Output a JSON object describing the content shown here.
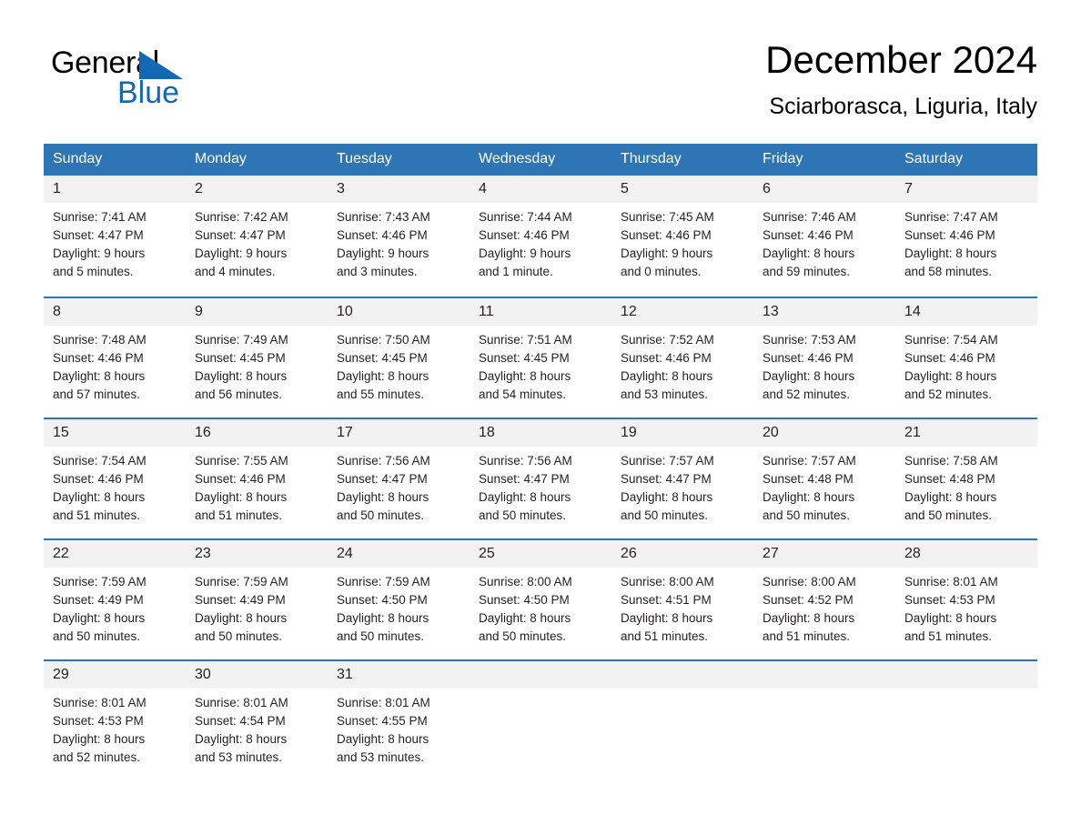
{
  "logo": {
    "word_one": "General",
    "word_two": "Blue",
    "triangle_color": "#1268b3",
    "blue_color": "#1268b3"
  },
  "header": {
    "month_title": "December 2024",
    "location": "Sciarborasca, Liguria, Italy"
  },
  "theme": {
    "header_blue": "#2e75b6",
    "day_number_bg": "#f2f2f2",
    "text": "#231f20"
  },
  "weekdays": [
    "Sunday",
    "Monday",
    "Tuesday",
    "Wednesday",
    "Thursday",
    "Friday",
    "Saturday"
  ],
  "weeks": [
    [
      {
        "day": "1",
        "sunrise": "Sunrise: 7:41 AM",
        "sunset": "Sunset: 4:47 PM",
        "daylight_line1": "Daylight: 9 hours",
        "daylight_line2": "and 5 minutes."
      },
      {
        "day": "2",
        "sunrise": "Sunrise: 7:42 AM",
        "sunset": "Sunset: 4:47 PM",
        "daylight_line1": "Daylight: 9 hours",
        "daylight_line2": "and 4 minutes."
      },
      {
        "day": "3",
        "sunrise": "Sunrise: 7:43 AM",
        "sunset": "Sunset: 4:46 PM",
        "daylight_line1": "Daylight: 9 hours",
        "daylight_line2": "and 3 minutes."
      },
      {
        "day": "4",
        "sunrise": "Sunrise: 7:44 AM",
        "sunset": "Sunset: 4:46 PM",
        "daylight_line1": "Daylight: 9 hours",
        "daylight_line2": "and 1 minute."
      },
      {
        "day": "5",
        "sunrise": "Sunrise: 7:45 AM",
        "sunset": "Sunset: 4:46 PM",
        "daylight_line1": "Daylight: 9 hours",
        "daylight_line2": "and 0 minutes."
      },
      {
        "day": "6",
        "sunrise": "Sunrise: 7:46 AM",
        "sunset": "Sunset: 4:46 PM",
        "daylight_line1": "Daylight: 8 hours",
        "daylight_line2": "and 59 minutes."
      },
      {
        "day": "7",
        "sunrise": "Sunrise: 7:47 AM",
        "sunset": "Sunset: 4:46 PM",
        "daylight_line1": "Daylight: 8 hours",
        "daylight_line2": "and 58 minutes."
      }
    ],
    [
      {
        "day": "8",
        "sunrise": "Sunrise: 7:48 AM",
        "sunset": "Sunset: 4:46 PM",
        "daylight_line1": "Daylight: 8 hours",
        "daylight_line2": "and 57 minutes."
      },
      {
        "day": "9",
        "sunrise": "Sunrise: 7:49 AM",
        "sunset": "Sunset: 4:45 PM",
        "daylight_line1": "Daylight: 8 hours",
        "daylight_line2": "and 56 minutes."
      },
      {
        "day": "10",
        "sunrise": "Sunrise: 7:50 AM",
        "sunset": "Sunset: 4:45 PM",
        "daylight_line1": "Daylight: 8 hours",
        "daylight_line2": "and 55 minutes."
      },
      {
        "day": "11",
        "sunrise": "Sunrise: 7:51 AM",
        "sunset": "Sunset: 4:45 PM",
        "daylight_line1": "Daylight: 8 hours",
        "daylight_line2": "and 54 minutes."
      },
      {
        "day": "12",
        "sunrise": "Sunrise: 7:52 AM",
        "sunset": "Sunset: 4:46 PM",
        "daylight_line1": "Daylight: 8 hours",
        "daylight_line2": "and 53 minutes."
      },
      {
        "day": "13",
        "sunrise": "Sunrise: 7:53 AM",
        "sunset": "Sunset: 4:46 PM",
        "daylight_line1": "Daylight: 8 hours",
        "daylight_line2": "and 52 minutes."
      },
      {
        "day": "14",
        "sunrise": "Sunrise: 7:54 AM",
        "sunset": "Sunset: 4:46 PM",
        "daylight_line1": "Daylight: 8 hours",
        "daylight_line2": "and 52 minutes."
      }
    ],
    [
      {
        "day": "15",
        "sunrise": "Sunrise: 7:54 AM",
        "sunset": "Sunset: 4:46 PM",
        "daylight_line1": "Daylight: 8 hours",
        "daylight_line2": "and 51 minutes."
      },
      {
        "day": "16",
        "sunrise": "Sunrise: 7:55 AM",
        "sunset": "Sunset: 4:46 PM",
        "daylight_line1": "Daylight: 8 hours",
        "daylight_line2": "and 51 minutes."
      },
      {
        "day": "17",
        "sunrise": "Sunrise: 7:56 AM",
        "sunset": "Sunset: 4:47 PM",
        "daylight_line1": "Daylight: 8 hours",
        "daylight_line2": "and 50 minutes."
      },
      {
        "day": "18",
        "sunrise": "Sunrise: 7:56 AM",
        "sunset": "Sunset: 4:47 PM",
        "daylight_line1": "Daylight: 8 hours",
        "daylight_line2": "and 50 minutes."
      },
      {
        "day": "19",
        "sunrise": "Sunrise: 7:57 AM",
        "sunset": "Sunset: 4:47 PM",
        "daylight_line1": "Daylight: 8 hours",
        "daylight_line2": "and 50 minutes."
      },
      {
        "day": "20",
        "sunrise": "Sunrise: 7:57 AM",
        "sunset": "Sunset: 4:48 PM",
        "daylight_line1": "Daylight: 8 hours",
        "daylight_line2": "and 50 minutes."
      },
      {
        "day": "21",
        "sunrise": "Sunrise: 7:58 AM",
        "sunset": "Sunset: 4:48 PM",
        "daylight_line1": "Daylight: 8 hours",
        "daylight_line2": "and 50 minutes."
      }
    ],
    [
      {
        "day": "22",
        "sunrise": "Sunrise: 7:59 AM",
        "sunset": "Sunset: 4:49 PM",
        "daylight_line1": "Daylight: 8 hours",
        "daylight_line2": "and 50 minutes."
      },
      {
        "day": "23",
        "sunrise": "Sunrise: 7:59 AM",
        "sunset": "Sunset: 4:49 PM",
        "daylight_line1": "Daylight: 8 hours",
        "daylight_line2": "and 50 minutes."
      },
      {
        "day": "24",
        "sunrise": "Sunrise: 7:59 AM",
        "sunset": "Sunset: 4:50 PM",
        "daylight_line1": "Daylight: 8 hours",
        "daylight_line2": "and 50 minutes."
      },
      {
        "day": "25",
        "sunrise": "Sunrise: 8:00 AM",
        "sunset": "Sunset: 4:50 PM",
        "daylight_line1": "Daylight: 8 hours",
        "daylight_line2": "and 50 minutes."
      },
      {
        "day": "26",
        "sunrise": "Sunrise: 8:00 AM",
        "sunset": "Sunset: 4:51 PM",
        "daylight_line1": "Daylight: 8 hours",
        "daylight_line2": "and 51 minutes."
      },
      {
        "day": "27",
        "sunrise": "Sunrise: 8:00 AM",
        "sunset": "Sunset: 4:52 PM",
        "daylight_line1": "Daylight: 8 hours",
        "daylight_line2": "and 51 minutes."
      },
      {
        "day": "28",
        "sunrise": "Sunrise: 8:01 AM",
        "sunset": "Sunset: 4:53 PM",
        "daylight_line1": "Daylight: 8 hours",
        "daylight_line2": "and 51 minutes."
      }
    ],
    [
      {
        "day": "29",
        "sunrise": "Sunrise: 8:01 AM",
        "sunset": "Sunset: 4:53 PM",
        "daylight_line1": "Daylight: 8 hours",
        "daylight_line2": "and 52 minutes."
      },
      {
        "day": "30",
        "sunrise": "Sunrise: 8:01 AM",
        "sunset": "Sunset: 4:54 PM",
        "daylight_line1": "Daylight: 8 hours",
        "daylight_line2": "and 53 minutes."
      },
      {
        "day": "31",
        "sunrise": "Sunrise: 8:01 AM",
        "sunset": "Sunset: 4:55 PM",
        "daylight_line1": "Daylight: 8 hours",
        "daylight_line2": "and 53 minutes."
      },
      {
        "day": "",
        "sunrise": "",
        "sunset": "",
        "daylight_line1": "",
        "daylight_line2": ""
      },
      {
        "day": "",
        "sunrise": "",
        "sunset": "",
        "daylight_line1": "",
        "daylight_line2": ""
      },
      {
        "day": "",
        "sunrise": "",
        "sunset": "",
        "daylight_line1": "",
        "daylight_line2": ""
      },
      {
        "day": "",
        "sunrise": "",
        "sunset": "",
        "daylight_line1": "",
        "daylight_line2": ""
      }
    ]
  ]
}
